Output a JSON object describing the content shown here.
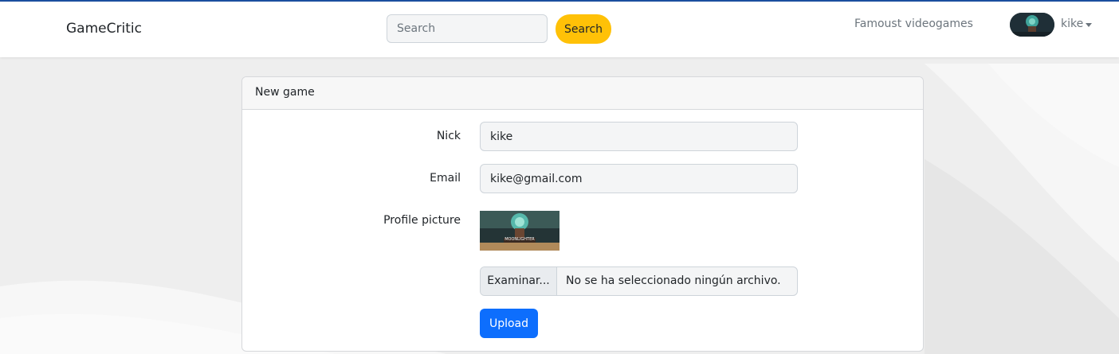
{
  "navbar": {
    "brand": "GameCritic",
    "search_placeholder": "Search",
    "search_button": "Search",
    "nav_link": "Famoust videogames",
    "username": "kike",
    "colors": {
      "accent": "#ffc107",
      "top_line": "#1b4fa0"
    }
  },
  "card": {
    "title": "New game",
    "fields": {
      "nick_label": "Nick",
      "nick_value": "kike",
      "email_label": "Email",
      "email_value": "kike@gmail.com",
      "picture_label": "Profile picture",
      "picture_caption": "MOONLIGHTER"
    },
    "file_input": {
      "button_label": "Examinar...",
      "status": "No se ha seleccionado ningún archivo."
    },
    "upload_button": "Upload",
    "colors": {
      "primary": "#0d6efd"
    }
  }
}
